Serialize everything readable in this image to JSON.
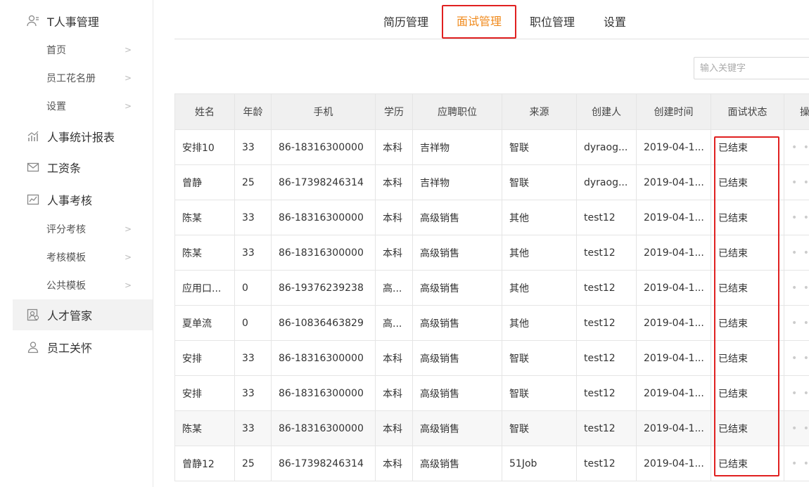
{
  "sidebar": {
    "menu": [
      {
        "label": "T人事管理",
        "icon": "user-manage-icon"
      },
      {
        "label": "人事统计报表",
        "icon": "bar-chart-icon"
      },
      {
        "label": "工资条",
        "icon": "mail-icon"
      },
      {
        "label": "人事考核",
        "icon": "line-chart-icon"
      },
      {
        "label": "人才管家",
        "icon": "talent-icon"
      },
      {
        "label": "员工关怀",
        "icon": "person-icon"
      }
    ],
    "sub_hr": [
      "首页",
      "员工花名册",
      "设置"
    ],
    "sub_exam": [
      "评分考核",
      "考核模板",
      "公共模板"
    ]
  },
  "tabs": [
    "简历管理",
    "面试管理",
    "职位管理",
    "设置"
  ],
  "search": {
    "placeholder": "输入关键字"
  },
  "table": {
    "headers": [
      "姓名",
      "年龄",
      "手机",
      "学历",
      "应聘职位",
      "来源",
      "创建人",
      "创建时间",
      "面试状态",
      "操"
    ],
    "rows": [
      [
        "安排10",
        "33",
        "86-18316300000",
        "本科",
        "吉祥物",
        "智联",
        "dyraog...",
        "2019-04-1...",
        "已结束"
      ],
      [
        "曾静",
        "25",
        "86-17398246314",
        "本科",
        "吉祥物",
        "智联",
        "dyraog...",
        "2019-04-1...",
        "已结束"
      ],
      [
        "陈某",
        "33",
        "86-18316300000",
        "本科",
        "高级销售",
        "其他",
        "test12",
        "2019-04-1...",
        "已结束"
      ],
      [
        "陈某",
        "33",
        "86-18316300000",
        "本科",
        "高级销售",
        "其他",
        "test12",
        "2019-04-1...",
        "已结束"
      ],
      [
        "应用口...",
        "0",
        "86-19376239238",
        "高...",
        "高级销售",
        "其他",
        "test12",
        "2019-04-1...",
        "已结束"
      ],
      [
        "夏单流",
        "0",
        "86-10836463829",
        "高...",
        "高级销售",
        "其他",
        "test12",
        "2019-04-1...",
        "已结束"
      ],
      [
        "安排",
        "33",
        "86-18316300000",
        "本科",
        "高级销售",
        "智联",
        "test12",
        "2019-04-1...",
        "已结束"
      ],
      [
        "安排",
        "33",
        "86-18316300000",
        "本科",
        "高级销售",
        "智联",
        "test12",
        "2019-04-1...",
        "已结束"
      ],
      [
        "陈某",
        "33",
        "86-18316300000",
        "本科",
        "高级销售",
        "智联",
        "test12",
        "2019-04-1...",
        "已结束"
      ],
      [
        "曾静12",
        "25",
        "86-17398246314",
        "本科",
        "高级销售",
        "51Job",
        "test12",
        "2019-04-1...",
        "已结束"
      ]
    ]
  },
  "colors": {
    "accent": "#f08a1c",
    "highlight": "#e02020"
  }
}
